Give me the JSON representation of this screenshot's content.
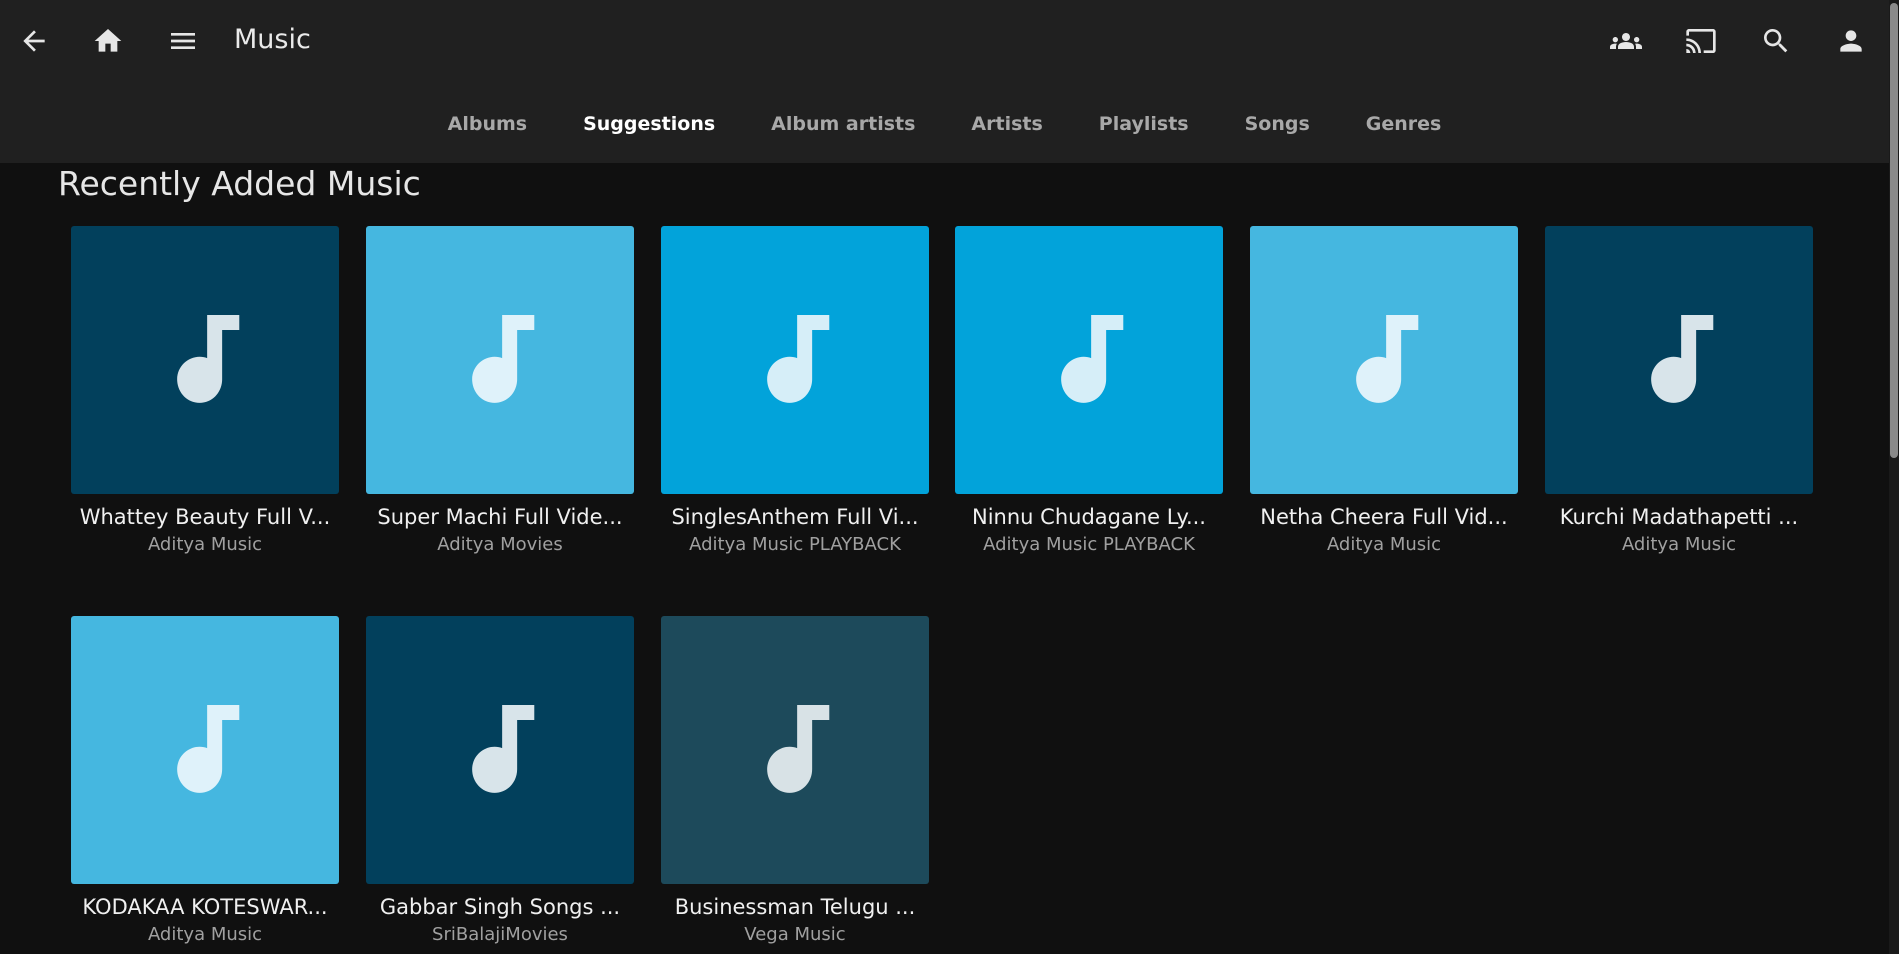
{
  "header": {
    "title": "Music",
    "tabs": [
      {
        "label": "Albums",
        "active": false
      },
      {
        "label": "Suggestions",
        "active": true
      },
      {
        "label": "Album artists",
        "active": false
      },
      {
        "label": "Artists",
        "active": false
      },
      {
        "label": "Playlists",
        "active": false
      },
      {
        "label": "Songs",
        "active": false
      },
      {
        "label": "Genres",
        "active": false
      }
    ],
    "icons": {
      "back": "arrow-left-icon",
      "home": "home-icon",
      "menu": "hamburger-menu-icon",
      "users": "users-group-icon",
      "cast": "cast-icon",
      "search": "search-icon",
      "user": "user-icon"
    }
  },
  "section": {
    "title": "Recently Added Music"
  },
  "items": [
    {
      "title": "Whattey Beauty Full V...",
      "subtitle": "Aditya Music",
      "color": "#02405c"
    },
    {
      "title": "Super Machi Full Vide...",
      "subtitle": "Aditya Movies",
      "color": "#45b7e0"
    },
    {
      "title": "SinglesAnthem Full Vi...",
      "subtitle": "Aditya Music PLAYBACK",
      "color": "#02a3da"
    },
    {
      "title": "Ninnu Chudagane Ly...",
      "subtitle": "Aditya Music PLAYBACK",
      "color": "#02a3da"
    },
    {
      "title": "Netha Cheera Full Vid...",
      "subtitle": "Aditya Music",
      "color": "#45b7e0"
    },
    {
      "title": "Kurchi Madathapetti ...",
      "subtitle": "Aditya Music",
      "color": "#02405c"
    },
    {
      "title": "KODAKAA KOTESWAR...",
      "subtitle": "Aditya Music",
      "color": "#45b7e0"
    },
    {
      "title": "Gabbar Singh Songs ...",
      "subtitle": "SriBalajiMovies",
      "color": "#02405c"
    },
    {
      "title": "Businessman Telugu ...",
      "subtitle": "Vega Music",
      "color": "#1d4a5b"
    }
  ],
  "colors": {
    "background": "#101010",
    "header": "#202020",
    "note_icon": "#d8eaf2"
  }
}
